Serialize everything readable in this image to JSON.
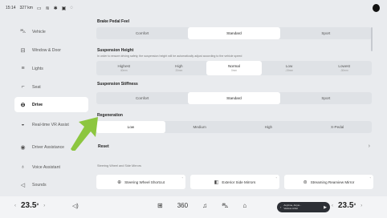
{
  "status": {
    "time": "15:14",
    "range": "327 km",
    "icons": [
      "battery-icon",
      "wifi-icon",
      "bluetooth-icon",
      "sim-icon",
      "location-icon"
    ]
  },
  "sidebar": {
    "items": [
      {
        "label": "Vehicle",
        "icon": "car-icon"
      },
      {
        "label": "Window & Door",
        "icon": "window-icon"
      },
      {
        "label": "Lights",
        "icon": "lights-icon"
      },
      {
        "label": "Seat",
        "icon": "seat-icon"
      },
      {
        "label": "Drive",
        "icon": "steering-icon",
        "active": true
      },
      {
        "label": "Real-time VR Assist",
        "icon": "vr-assist-icon"
      },
      {
        "label": "Driver Assistance",
        "icon": "driver-assist-icon"
      },
      {
        "label": "Voice Assistant",
        "icon": "mic-icon"
      },
      {
        "label": "Sounds",
        "icon": "speaker-icon"
      }
    ]
  },
  "main": {
    "brake_pedal": {
      "title": "Brake Pedal Feel",
      "options": [
        "Comfort",
        "Standard",
        "Sport"
      ],
      "selected": "Standard"
    },
    "suspension_height": {
      "title": "Suspension Height",
      "desc": "In order to ensure driving safety, the suspension height will be automatically adjust according to the vehicle speed",
      "options": [
        {
          "label": "Highest",
          "sub": "40mm"
        },
        {
          "label": "High",
          "sub": "20mm"
        },
        {
          "label": "Normal",
          "sub": "0mm"
        },
        {
          "label": "Low",
          "sub": "-15mm"
        },
        {
          "label": "Lowest",
          "sub": "-30mm"
        }
      ],
      "selected": "Normal"
    },
    "suspension_stiffness": {
      "title": "Suspension Stiffness",
      "options": [
        "Comfort",
        "Standard",
        "Sport"
      ],
      "selected": "Standard"
    },
    "regeneration": {
      "title": "Regeneration",
      "options": [
        "Low",
        "Medium",
        "High",
        "X-Pedal"
      ],
      "selected": "Low"
    },
    "reset_label": "Reset",
    "mirrors_label": "Steering Wheel and Side Mirrors",
    "mirror_buttons": [
      {
        "label": "Steering Wheel Shortcut",
        "icon": "steering-wheel-icon"
      },
      {
        "label": "Exterior Side Mirrors",
        "icon": "side-mirror-icon"
      },
      {
        "label": "Streaming Rearview Mirror",
        "icon": "rearview-mirror-icon"
      }
    ]
  },
  "bottom": {
    "left_temp": "23.5",
    "right_temp": "23.5",
    "degree": "°",
    "dock": [
      "apps-icon",
      "360-camera-icon",
      "music-icon",
      "car-icon",
      "home-icon"
    ],
    "dock_glyphs": [
      "⊞",
      "360",
      "♫",
      "⛍",
      "⌂"
    ],
    "media_title": "Anytime, Anyw...",
    "media_artist": "Various Artist"
  },
  "colors": {
    "background": "#e9ebee",
    "selected_segment": "#ffffff",
    "arrow": "#8cc63f"
  }
}
